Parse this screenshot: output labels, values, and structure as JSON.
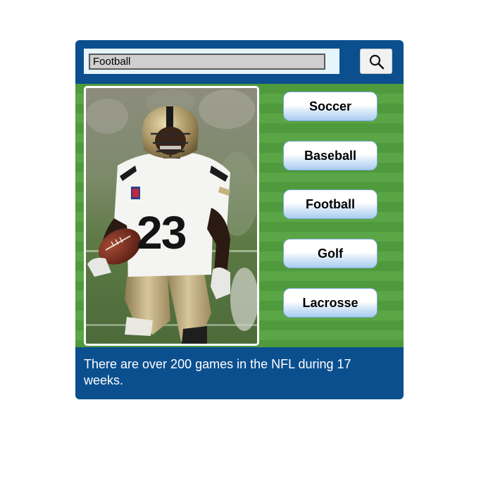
{
  "search": {
    "value": "Football",
    "button_icon": "search-icon"
  },
  "photo": {
    "subject": "football-player-photo",
    "jersey_number": "23"
  },
  "sports": [
    {
      "label": "Soccer"
    },
    {
      "label": "Baseball"
    },
    {
      "label": "Football"
    },
    {
      "label": "Golf"
    },
    {
      "label": "Lacrosse"
    }
  ],
  "caption": "There are over 200 games in the NFL during 17 weeks.",
  "colors": {
    "panel": "#0b4f8f",
    "field_dark": "#4f9a3c",
    "field_light": "#5aa546",
    "button_gradient_bottom": "#aacdef"
  }
}
